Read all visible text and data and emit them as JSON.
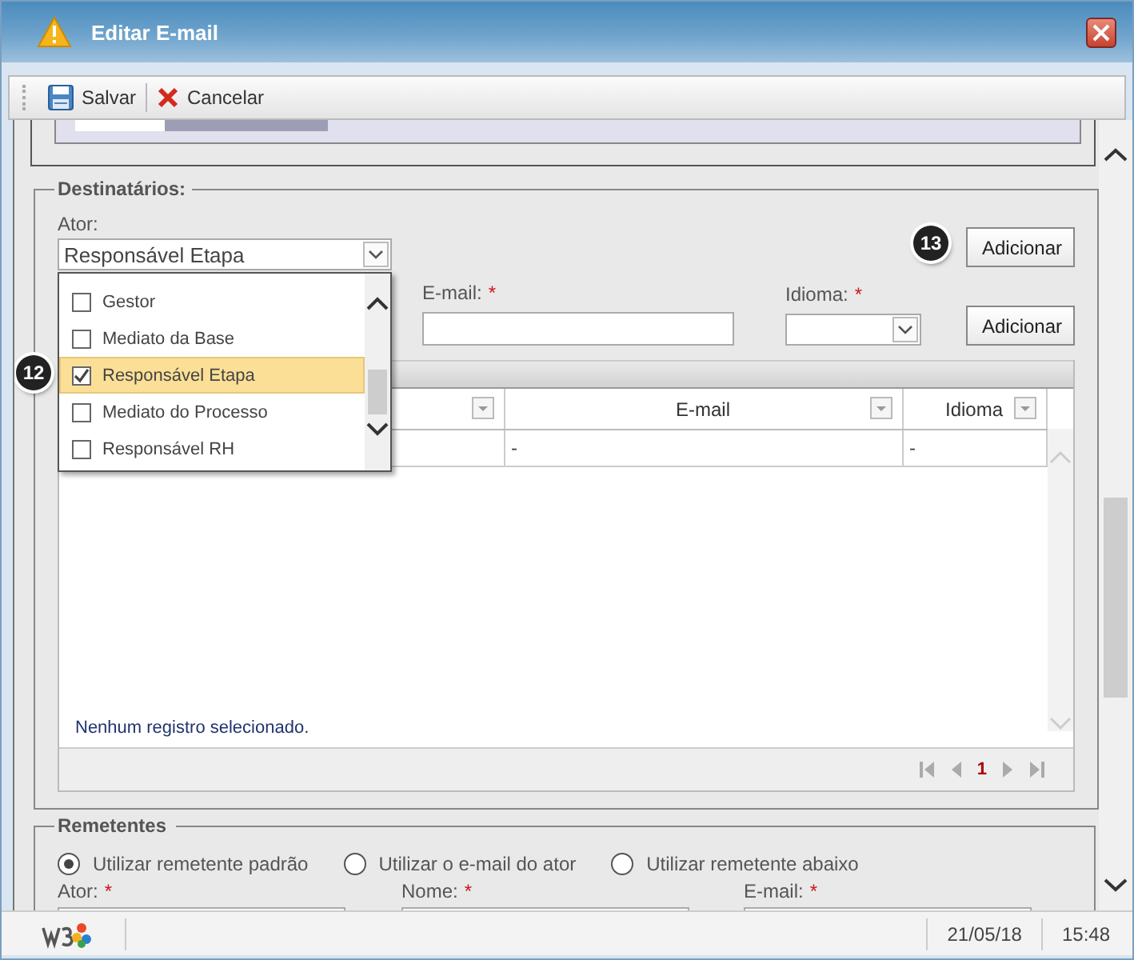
{
  "window": {
    "title": "Editar E-mail"
  },
  "toolbar": [
    {
      "label": "Salvar",
      "kind": "save"
    },
    {
      "label": "Cancelar",
      "kind": "cancel"
    }
  ],
  "recipients": {
    "legend": "Destinatários:",
    "ator": {
      "label": "Ator:",
      "value": "Responsável Etapa",
      "expanded": true,
      "options": [
        {
          "label": "Gestor",
          "checked": false,
          "selected": false
        },
        {
          "label": "Mediato da Base",
          "checked": false,
          "selected": false
        },
        {
          "label": "Responsável Etapa",
          "checked": true,
          "selected": true
        },
        {
          "label": "Mediato do Processo",
          "checked": false,
          "selected": false
        },
        {
          "label": "Responsável RH",
          "checked": false,
          "selected": false
        }
      ]
    },
    "add_actor_button": "Adicionar",
    "email": {
      "label": "E-mail:",
      "required_mark": "*"
    },
    "idioma": {
      "label": "Idioma:",
      "required_mark": "*"
    },
    "add_email_button": "Adicionar",
    "table": {
      "columns": [
        "E-mail",
        "Idioma"
      ],
      "rows": [
        [
          "-",
          "-"
        ]
      ],
      "empty_message": "Nenhum registro selecionado.",
      "page": "1"
    }
  },
  "senders": {
    "legend": "Remetentes",
    "options": [
      {
        "label": "Utilizar remetente padrão",
        "selected": true
      },
      {
        "label": "Utilizar o e-mail do ator",
        "selected": false
      },
      {
        "label": "Utilizar remetente abaixo",
        "selected": false
      }
    ],
    "fields": [
      {
        "label": "Ator:",
        "required_mark": "*"
      },
      {
        "label": "Nome:",
        "required_mark": "*"
      },
      {
        "label": "E-mail:",
        "required_mark": "*"
      }
    ]
  },
  "callouts": [
    "12",
    "13"
  ],
  "status_bar": {
    "date": "21/05/18",
    "time": "15:48"
  }
}
